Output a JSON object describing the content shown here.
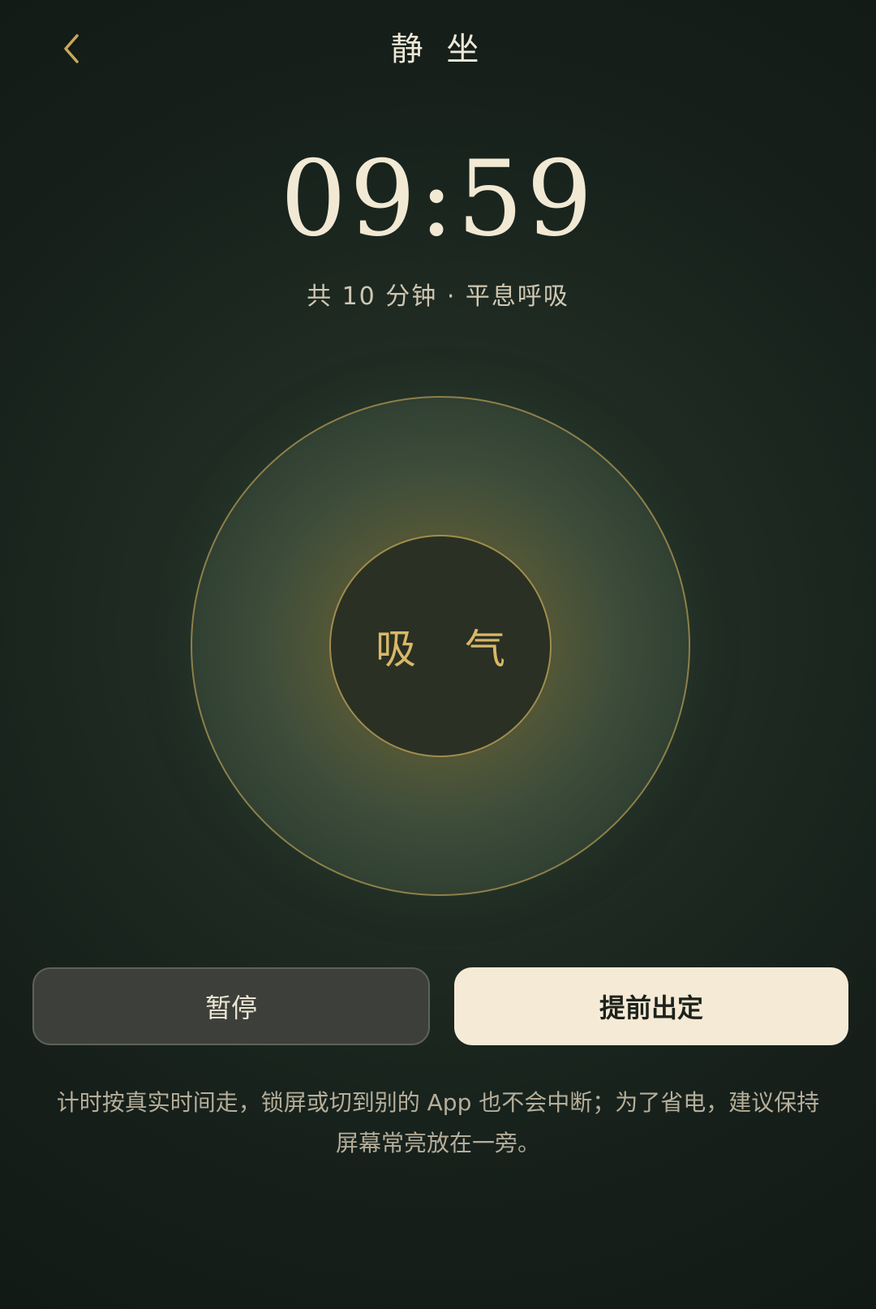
{
  "header": {
    "title": "静 坐",
    "back_icon": "chevron-left-icon"
  },
  "timer": {
    "remaining": "09:59"
  },
  "session": {
    "info": "共 10 分钟 · 平息呼吸"
  },
  "breath": {
    "phase_label": "吸 气"
  },
  "actions": {
    "pause_label": "暂停",
    "finish_label": "提前出定"
  },
  "note": {
    "text": "计时按真实时间走，锁屏或切到别的 App 也不会中断；为了省电，建议保持屏幕常亮放在一旁。"
  },
  "colors": {
    "accent_gold": "#c9a85a",
    "background": "#1a241e",
    "primary_button": "#f5ead5"
  }
}
